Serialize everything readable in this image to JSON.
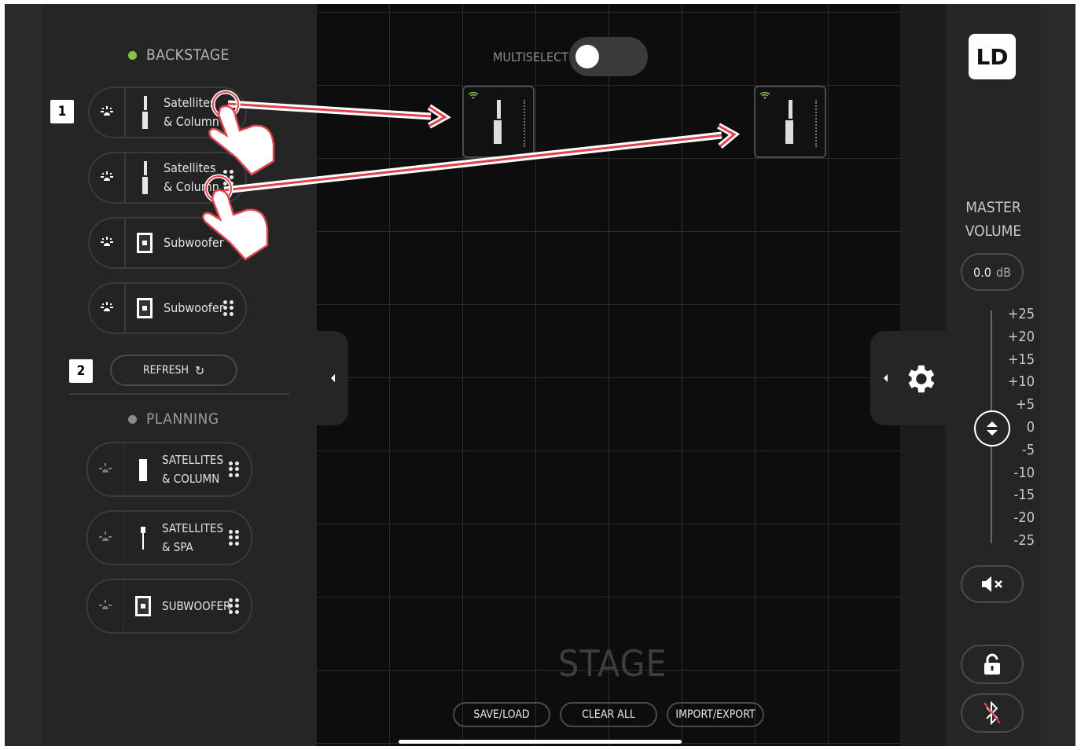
{
  "sidebar": {
    "backstage_title": "BACKSTAGE",
    "backstage_dot_color": "#8bc34a",
    "step1": "1",
    "step2": "2",
    "backstage_items": [
      {
        "line1": "Satellites",
        "line2": "& Column",
        "icon": "column-speaker-icon"
      },
      {
        "line1": "Satellites",
        "line2": "& Column",
        "icon": "column-speaker-icon"
      },
      {
        "line1": "Subwoofer",
        "line2": "",
        "icon": "subwoofer-icon"
      },
      {
        "line1": "Subwoofer",
        "line2": "",
        "icon": "subwoofer-icon"
      }
    ],
    "refresh_label": "REFRESH",
    "planning_title": "PLANNING",
    "planning_dot_color": "#8a8a8a",
    "planning_items": [
      {
        "line1": "SATELLITES",
        "line2": "& COLUMN",
        "icon": "column-speaker-icon"
      },
      {
        "line1": "SATELLITES",
        "line2": "& SPA",
        "icon": "satellite-stand-icon"
      },
      {
        "line1": "SUBWOOFER",
        "line2": "",
        "icon": "subwoofer-icon"
      }
    ]
  },
  "stage": {
    "multiselect_label": "MULTISELECT",
    "multiselect_on": false,
    "title": "STAGE",
    "buttons": {
      "save_load": "SAVE/LOAD",
      "clear_all": "CLEAR ALL",
      "import_export": "IMPORT/EXPORT"
    }
  },
  "right": {
    "logo": "LD",
    "master_volume_line1": "MASTER",
    "master_volume_line2": "VOLUME",
    "volume_value": "0.0",
    "volume_unit": "dB",
    "scale": [
      "+25",
      "+20",
      "+15",
      "+10",
      "+5",
      "0",
      "-5",
      "-10",
      "-15",
      "-20",
      "-25"
    ]
  },
  "colors": {
    "accent_green": "#8bc34a",
    "arrow_red": "#e0454f"
  }
}
